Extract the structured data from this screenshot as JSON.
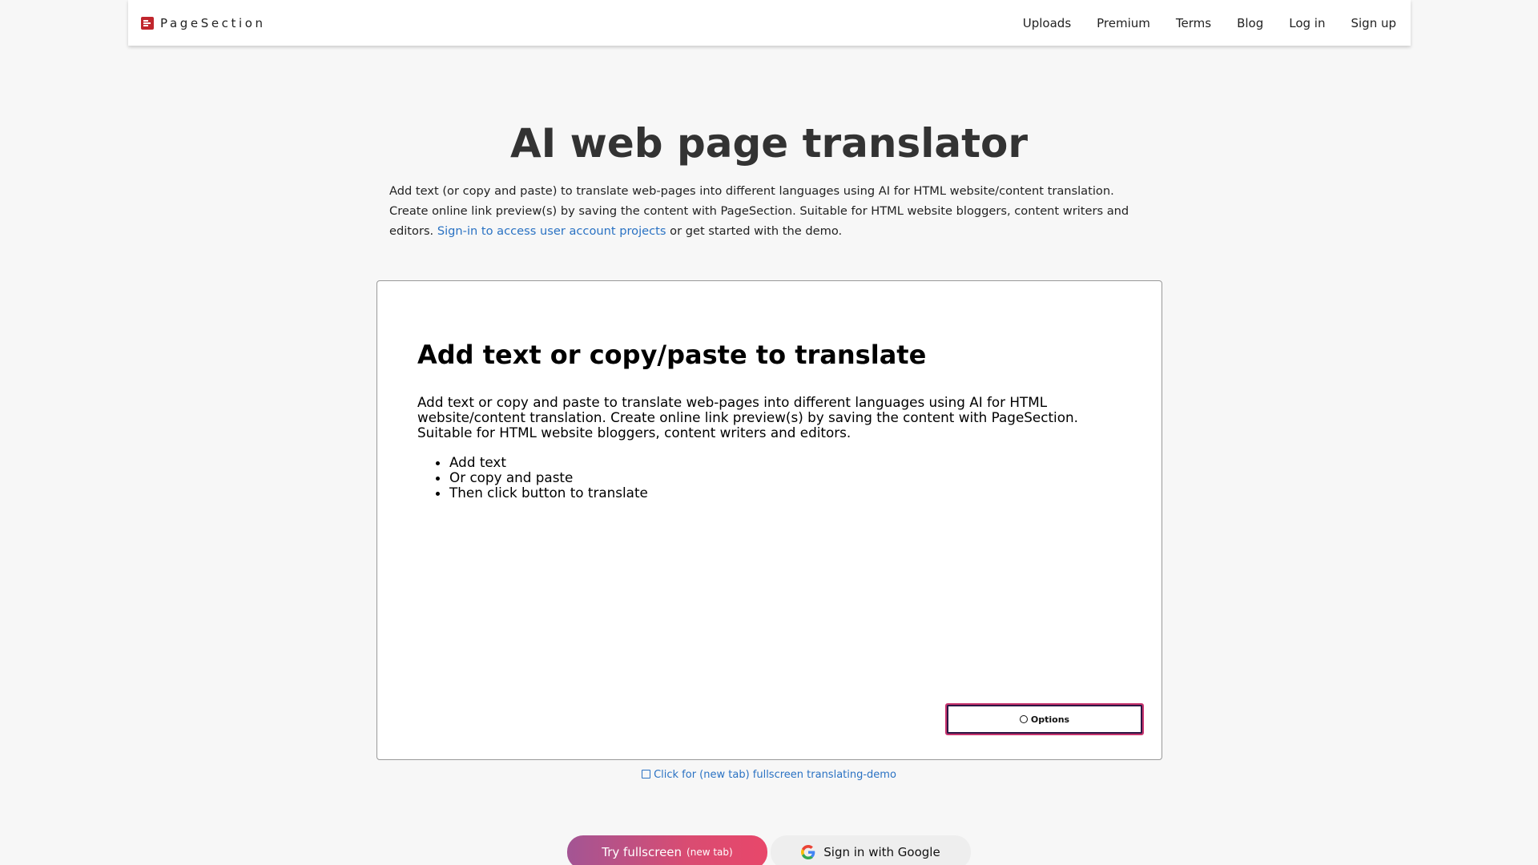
{
  "brand": {
    "name": "PageSection"
  },
  "nav": {
    "links": [
      "Uploads",
      "Premium",
      "Terms",
      "Blog",
      "Log in",
      "Sign up"
    ]
  },
  "hero": {
    "title": "AI web page translator",
    "desc_before": "Add text (or copy and paste) to translate web-pages into different languages using AI for HTML website/content translation. Create online link preview(s) by saving the content with PageSection. Suitable for HTML website bloggers, content writers and editors. ",
    "desc_link": "Sign-in to access user account projects",
    "desc_after": " or get started with the demo."
  },
  "demo": {
    "heading": "Add text or copy/paste to translate",
    "paragraph": "Add text or copy and paste to translate web-pages into different languages using AI for HTML website/content translation. Create online link preview(s) by saving the content with PageSection. Suitable for HTML website bloggers, content writers and editors.",
    "list": [
      "Add text",
      "Or copy and paste",
      "Then click button to translate"
    ],
    "options_label": "Options"
  },
  "fullscreen_link": "Click for (new tab) fullscreen translating-demo",
  "buttons": {
    "try_label": "Try fullscreen",
    "try_sub": "(new tab)",
    "google_label": "Sign in with Google"
  },
  "colors": {
    "brand_red": "#c0262d",
    "link_blue": "#2a72c3",
    "gradient_start": "#a35594",
    "gradient_end": "#e8476a"
  }
}
